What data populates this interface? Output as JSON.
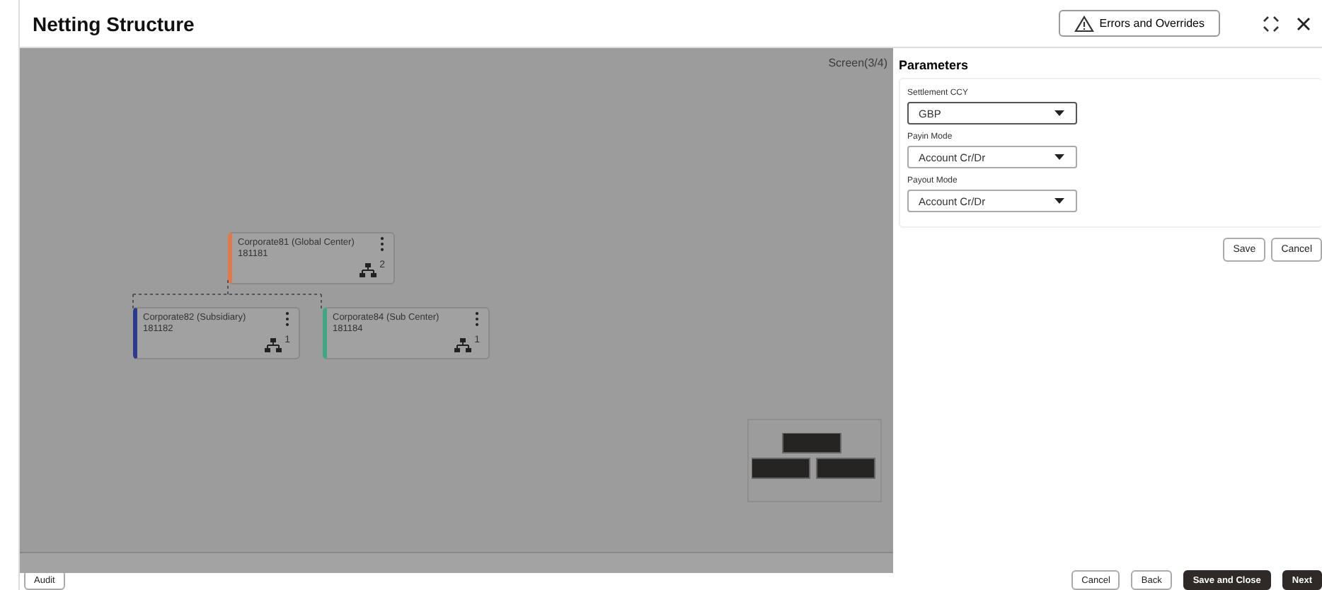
{
  "window": {
    "title": "Netting Structure"
  },
  "header": {
    "errors_button": "Errors and Overrides"
  },
  "canvas": {
    "screen_label": "Screen(3/4)",
    "tree": {
      "name": "Corporate81 (Global Center)",
      "id": "181181",
      "count": "2",
      "color": "#e07a4a",
      "children": [
        {
          "name": "Corporate82 (Subsidiary)",
          "id": "181182",
          "count": "1",
          "color": "#2b3a8c"
        },
        {
          "name": "Corporate84 (Sub Center)",
          "id": "181184",
          "count": "1",
          "color": "#3fa882"
        }
      ]
    }
  },
  "parameters": {
    "title": "Parameters",
    "fields": [
      {
        "label": "Settlement CCY",
        "value": "GBP",
        "selected": true
      },
      {
        "label": "Payin Mode",
        "value": "Account Cr/Dr",
        "selected": false
      },
      {
        "label": "Payout Mode",
        "value": "Account Cr/Dr",
        "selected": false
      }
    ],
    "buttons": [
      "Save",
      "Cancel"
    ]
  },
  "footer": {
    "left_button": "Audit",
    "buttons": [
      {
        "label": "Cancel",
        "kind": "plain"
      },
      {
        "label": "Back",
        "kind": "plain"
      },
      {
        "label": "Save and Close",
        "kind": "primary"
      },
      {
        "label": "Next",
        "kind": "primary"
      }
    ]
  }
}
